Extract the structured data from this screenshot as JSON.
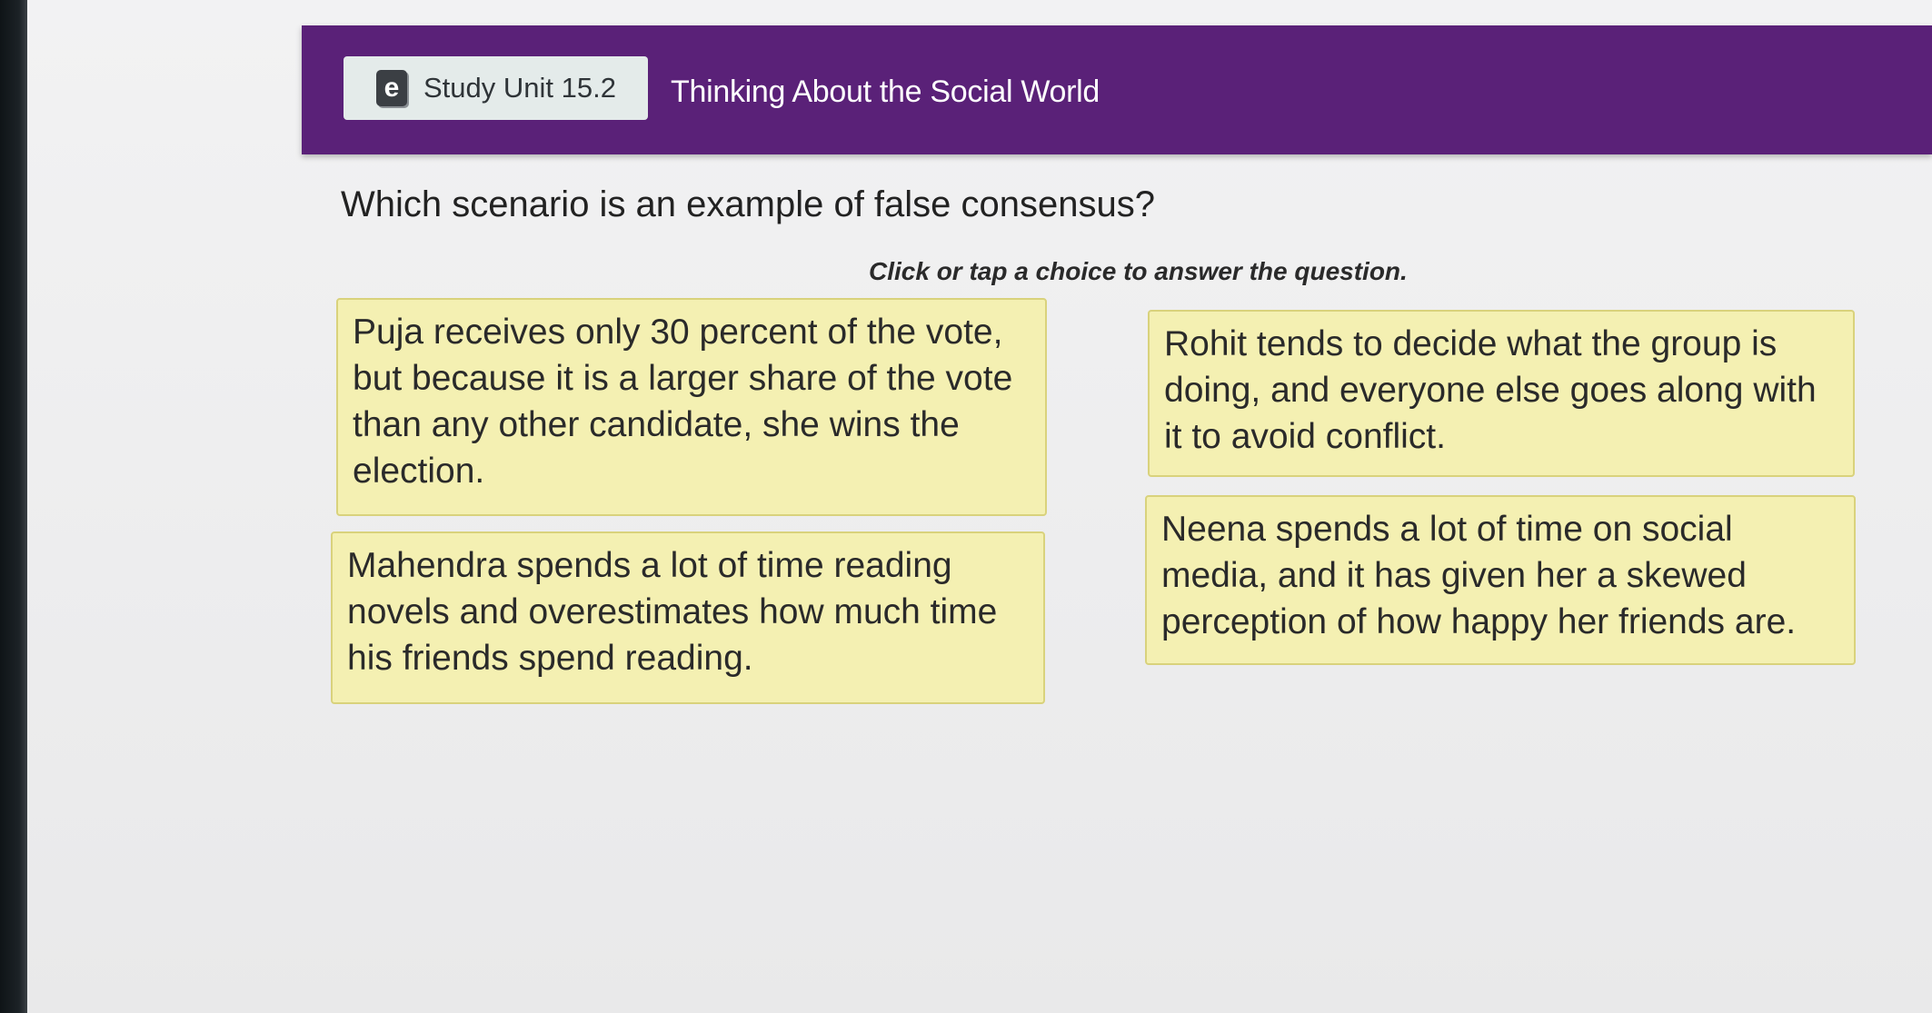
{
  "header": {
    "icon": "ebook-icon",
    "icon_glyph": "e",
    "unit_label": "Study Unit 15.2",
    "unit_title": "Thinking About the Social World"
  },
  "question": {
    "prompt": "Which scenario is an example of false consensus?",
    "instruction": "Click or tap a choice to answer the question."
  },
  "choices": [
    {
      "text": "Puja receives only 30 percent of the vote, but because it is a larger share of the vote than any other candidate, she wins the election."
    },
    {
      "text": "Rohit tends to decide what the group is doing, and everyone else goes along with it to avoid conflict."
    },
    {
      "text": "Mahendra spends a lot of time reading novels and overestimates how much time his friends spend reading."
    },
    {
      "text": "Neena spends a lot of time on social media, and it has given her a skewed perception of how happy her friends are."
    }
  ],
  "colors": {
    "header_bg": "#5a2178",
    "choice_bg": "#f4f0b2",
    "choice_border": "#d9d27c"
  }
}
